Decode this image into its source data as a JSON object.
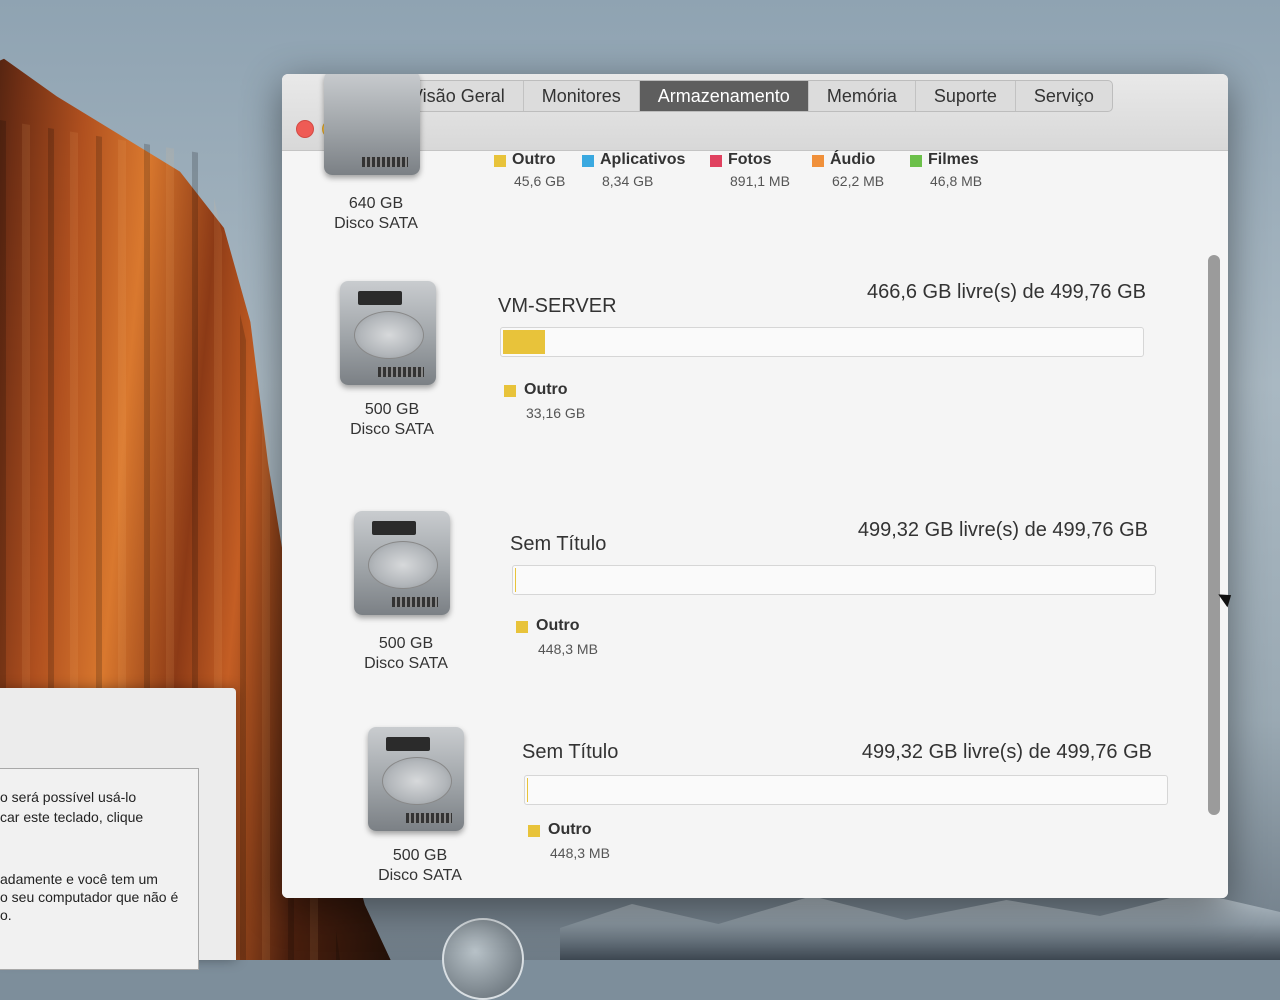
{
  "tabs": [
    {
      "label": "Visão Geral"
    },
    {
      "label": "Monitores"
    },
    {
      "label": "Armazenamento",
      "active": true
    },
    {
      "label": "Memória"
    },
    {
      "label": "Suporte"
    },
    {
      "label": "Serviço"
    }
  ],
  "categories": [
    {
      "name": "Outro",
      "value": "45,6 GB",
      "color": "#e8c33a"
    },
    {
      "name": "Aplicativos",
      "value": "8,34 GB",
      "color": "#3aa9e0"
    },
    {
      "name": "Fotos",
      "value": "891,1 MB",
      "color": "#e0415f"
    },
    {
      "name": "Áudio",
      "value": "62,2 MB",
      "color": "#f0903a"
    },
    {
      "name": "Filmes",
      "value": "46,8 MB",
      "color": "#6cc04a"
    }
  ],
  "drives": [
    {
      "size": "640 GB",
      "type": "Disco SATA"
    },
    {
      "size": "500 GB",
      "type": "Disco SATA",
      "volume": "VM-SERVER",
      "free": "466,6 GB livre(s) de 499,76 GB",
      "legend_name": "Outro",
      "legend_value": "33,16 GB",
      "used_fraction": 0.066
    },
    {
      "size": "500 GB",
      "type": "Disco SATA",
      "volume": "Sem Título",
      "free": "499,32 GB livre(s) de 499,76 GB",
      "legend_name": "Outro",
      "legend_value": "448,3 MB",
      "used_fraction": 0.001
    },
    {
      "size": "500 GB",
      "type": "Disco SATA",
      "volume": "Sem Título",
      "free": "499,32 GB livre(s) de 499,76 GB",
      "legend_name": "Outro",
      "legend_value": "448,3 MB",
      "used_fraction": 0.001
    }
  ],
  "dialog": {
    "lines": [
      "o será possível usá-lo",
      "car este teclado, clique",
      "adamente e você tem um",
      "o seu computador que não é",
      "o."
    ]
  }
}
